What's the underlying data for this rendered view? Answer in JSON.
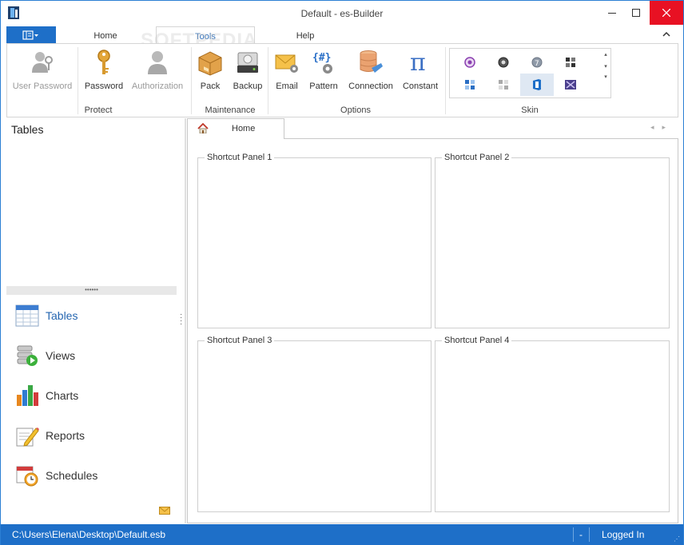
{
  "window": {
    "title": "Default - es-Builder"
  },
  "watermark": "SOFTPEDIA",
  "ribbon": {
    "tabs": [
      {
        "label": "Home"
      },
      {
        "label": "Tools"
      },
      {
        "label": "Help"
      }
    ],
    "active_tab": "Tools",
    "groups": {
      "protect": {
        "label": "Protect",
        "buttons": [
          {
            "label": "User Password",
            "icon": "user-key-icon",
            "enabled": false
          },
          {
            "label": "Password",
            "icon": "key-icon",
            "enabled": true
          },
          {
            "label": "Authorization",
            "icon": "user-icon",
            "enabled": false
          }
        ]
      },
      "maintenance": {
        "label": "Maintenance",
        "buttons": [
          {
            "label": "Pack",
            "icon": "box-icon"
          },
          {
            "label": "Backup",
            "icon": "drive-backup-icon"
          }
        ]
      },
      "options": {
        "label": "Options",
        "buttons": [
          {
            "label": "Email",
            "icon": "email-gear-icon"
          },
          {
            "label": "Pattern",
            "icon": "pattern-gear-icon"
          },
          {
            "label": "Connection",
            "icon": "database-connection-icon"
          },
          {
            "label": "Constant",
            "icon": "pi-icon"
          }
        ]
      },
      "skin": {
        "label": "Skin"
      }
    }
  },
  "left_pane": {
    "title": "Tables",
    "splitter_grip": "••••••",
    "nav": [
      {
        "label": "Tables",
        "icon": "table-icon",
        "active": true
      },
      {
        "label": "Views",
        "icon": "views-play-icon",
        "active": false
      },
      {
        "label": "Charts",
        "icon": "bar-chart-icon",
        "active": false
      },
      {
        "label": "Reports",
        "icon": "report-pencil-icon",
        "active": false
      },
      {
        "label": "Schedules",
        "icon": "calendar-clock-icon",
        "active": false
      }
    ]
  },
  "document": {
    "tab_label": "Home",
    "panels": [
      {
        "title": "Shortcut Panel 1"
      },
      {
        "title": "Shortcut Panel 2"
      },
      {
        "title": "Shortcut Panel 3"
      },
      {
        "title": "Shortcut Panel 4"
      }
    ]
  },
  "statusbar": {
    "path": "C:\\Users\\Elena\\Desktop\\Default.esb",
    "middle": "-",
    "login": "Logged In"
  },
  "colors": {
    "accent": "#1e6fc8",
    "close": "#e81123",
    "active_text": "#2465b0"
  }
}
